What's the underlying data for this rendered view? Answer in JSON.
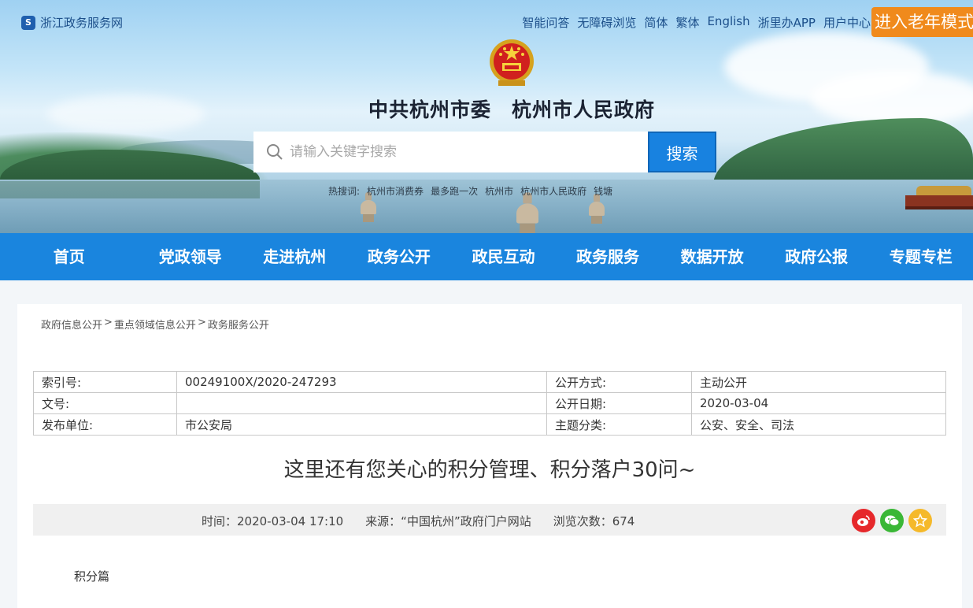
{
  "header": {
    "site_name": "浙江政务服务网",
    "util_links": [
      "智能问答",
      "无障碍浏览",
      "简体",
      "繁体",
      "English",
      "浙里办APP",
      "用户中心"
    ],
    "elder_mode": "进入老年模式",
    "title": "中共杭州市委　杭州市人民政府",
    "search_placeholder": "请输入关键字搜索",
    "search_button": "搜索",
    "hot_label": "热搜词:",
    "hot_words": [
      "杭州市消费券",
      "最多跑一次",
      "杭州市",
      "杭州市人民政府",
      "钱塘"
    ]
  },
  "nav": [
    "首页",
    "党政领导",
    "走进杭州",
    "政务公开",
    "政民互动",
    "政务服务",
    "数据开放",
    "政府公报",
    "专题专栏"
  ],
  "breadcrumb": [
    "政府信息公开",
    ">",
    "重点领域信息公开",
    ">",
    "政务服务公开"
  ],
  "meta": {
    "rows": [
      [
        "索引号:",
        "00249100X/2020-247293",
        "公开方式:",
        "主动公开"
      ],
      [
        "文号:",
        "",
        "公开日期:",
        "2020-03-04"
      ],
      [
        "发布单位:",
        "市公安局",
        "主题分类:",
        "公安、安全、司法"
      ]
    ]
  },
  "article": {
    "title": "这里还有您关心的积分管理、积分落户30问~",
    "time": "时间：2020-03-04 17:10",
    "source": "来源：“中国杭州”政府门户网站",
    "views": "浏览次数：674",
    "section": "积分篇"
  },
  "colors": {
    "nav_blue": "#1a85de",
    "elder_orange": "#f08a1c",
    "weibo": "#e6282b",
    "wechat": "#3ab736",
    "fav": "#f5b92a"
  }
}
